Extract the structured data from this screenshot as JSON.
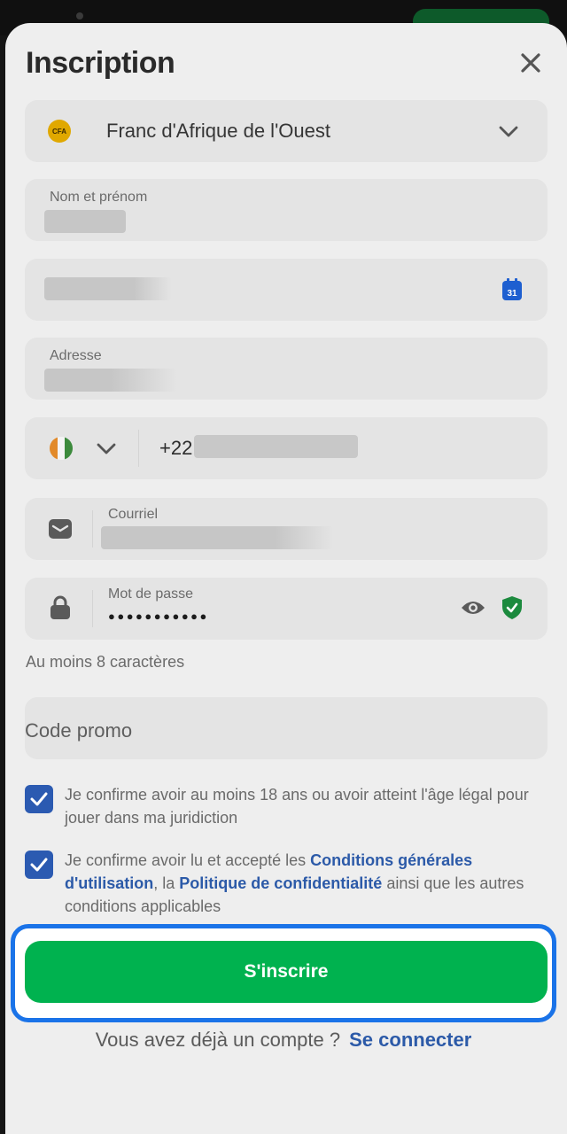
{
  "title": "Inscription",
  "currency": {
    "code": "CFA",
    "label": "Franc d'Afrique de l'Ouest"
  },
  "fields": {
    "fullname_label": "Nom et prénom",
    "address_label": "Adresse",
    "phone_prefix": "+22",
    "email_label": "Courriel",
    "password_label": "Mot de passe",
    "password_value": "●●●●●●●●●●●",
    "password_hint": "Au moins 8 caractères",
    "promo_placeholder": "Code promo",
    "calendar_day": "31"
  },
  "checkboxes": {
    "age_text": "Je confirme avoir au moins 18 ans ou avoir atteint l'âge légal pour jouer dans ma juridiction",
    "terms_pre": "Je confirme avoir lu et accepté les ",
    "terms_link": "Conditions générales d'utilisation",
    "terms_mid": ", la ",
    "privacy_link": "Politique de confidentialité",
    "terms_post": " ainsi que les autres conditions applicables"
  },
  "submit_label": "S'inscrire",
  "footer": {
    "question": "Vous avez déjà un compte ?",
    "login_link": "Se connecter"
  },
  "colors": {
    "accent_green": "#00b24f",
    "link_blue": "#2c5aa8",
    "checkbox_blue": "#2b5ab1",
    "highlight_blue": "#1a73e8"
  }
}
